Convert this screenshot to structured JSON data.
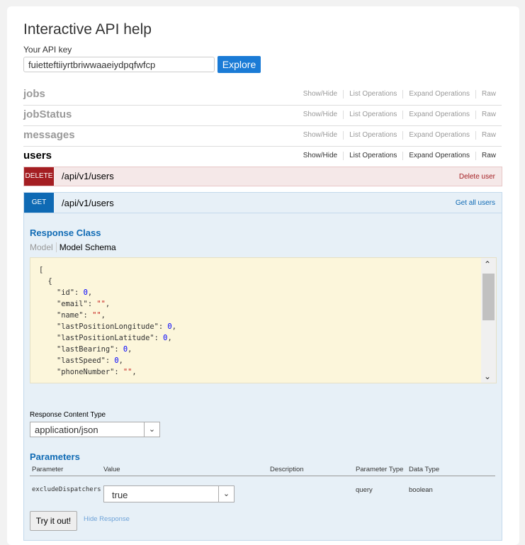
{
  "title": "Interactive API help",
  "api_key": {
    "label": "Your API key",
    "value": "fuietteftiiyrtbriwwaaeiydpqfwfcp"
  },
  "explore_label": "Explore",
  "resources": [
    {
      "name": "jobs",
      "links": [
        "Show/Hide",
        "List Operations",
        "Expand Operations",
        "Raw"
      ]
    },
    {
      "name": "jobStatus",
      "links": [
        "Show/Hide",
        "List Operations",
        "Expand Operations",
        "Raw"
      ]
    },
    {
      "name": "messages",
      "links": [
        "Show/Hide",
        "List Operations",
        "Expand Operations",
        "Raw"
      ]
    },
    {
      "name": "users",
      "links": [
        "Show/Hide",
        "List Operations",
        "Expand Operations",
        "Raw"
      ]
    }
  ],
  "delete_op": {
    "method": "DELETE",
    "path": "/api/v1/users",
    "summary": "Delete user",
    "color": "#a41e22"
  },
  "get_op": {
    "method": "GET",
    "path": "/api/v1/users",
    "summary": "Get all users",
    "color": "#0f6ab4",
    "response_class": "Response Class",
    "model_tab": "Model",
    "schema_tab": "Model Schema",
    "schema_lines": [
      "[",
      "  {",
      "    \"id\": 0,",
      "    \"email\": \"\",",
      "    \"name\": \"\",",
      "    \"lastPositionLongitude\": 0,",
      "    \"lastPositionLatitude\": 0,",
      "    \"lastBearing\": 0,",
      "    \"lastSpeed\": 0,",
      "    \"phoneNumber\": \"\","
    ],
    "response_content_type_label": "Response Content Type",
    "response_content_type": "application/json",
    "parameters_heading": "Parameters",
    "param_headers": {
      "parameter": "Parameter",
      "value": "Value",
      "description": "Description",
      "type": "Parameter Type",
      "data_type": "Data Type"
    },
    "param": {
      "name": "excludeDispatchers",
      "value": "true",
      "type": "query",
      "data_type": "boolean"
    },
    "try_label": "Try it out!",
    "hide_response_label": "Hide Response"
  }
}
